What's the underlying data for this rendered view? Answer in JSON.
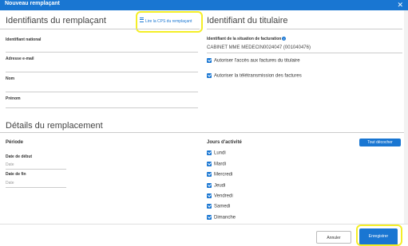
{
  "window": {
    "title": "Nouveau remplaçant",
    "close_glyph": "✕"
  },
  "left_section": {
    "title": "Identifiants du remplaçant",
    "lire_cps_label": "Lire la CPS du remplaçant",
    "fields": [
      {
        "label": "Identifiant national",
        "value": ""
      },
      {
        "label": "Adresse e-mail",
        "value": ""
      },
      {
        "label": "Nom",
        "value": ""
      },
      {
        "label": "Prénom",
        "value": ""
      }
    ]
  },
  "right_section": {
    "title": "Identifiant du titulaire",
    "facturation_label": "Identifiant de la situation de facturation",
    "facturation_value": "CABINET MME MEDECIN0024047 (001040476)",
    "checkboxes": [
      {
        "label": "Autoriser l'accès aux factures du titulaire",
        "checked": true
      },
      {
        "label": "Autoriser la télétransmission des factures",
        "checked": true
      }
    ]
  },
  "details": {
    "title": "Détails du remplacement",
    "periode": {
      "title": "Période",
      "date_debut_label": "Date de début",
      "date_debut_placeholder": "Date",
      "date_fin_label": "Date de fin",
      "date_fin_placeholder": "Date"
    },
    "jours": {
      "title": "Jours d'activité",
      "tout_decocher": "Tout décocher",
      "days": [
        {
          "label": "Lundi",
          "checked": true
        },
        {
          "label": "Mardi",
          "checked": true
        },
        {
          "label": "Mercredi",
          "checked": true
        },
        {
          "label": "Jeudi",
          "checked": true
        },
        {
          "label": "Vendredi",
          "checked": true
        },
        {
          "label": "Samedi",
          "checked": true
        },
        {
          "label": "Dimanche",
          "checked": true
        }
      ]
    }
  },
  "footer": {
    "cancel_label": "Annuler",
    "save_label": "Enregistrer"
  },
  "colors": {
    "accent": "#1976d2",
    "highlight": "#f4ee28"
  }
}
